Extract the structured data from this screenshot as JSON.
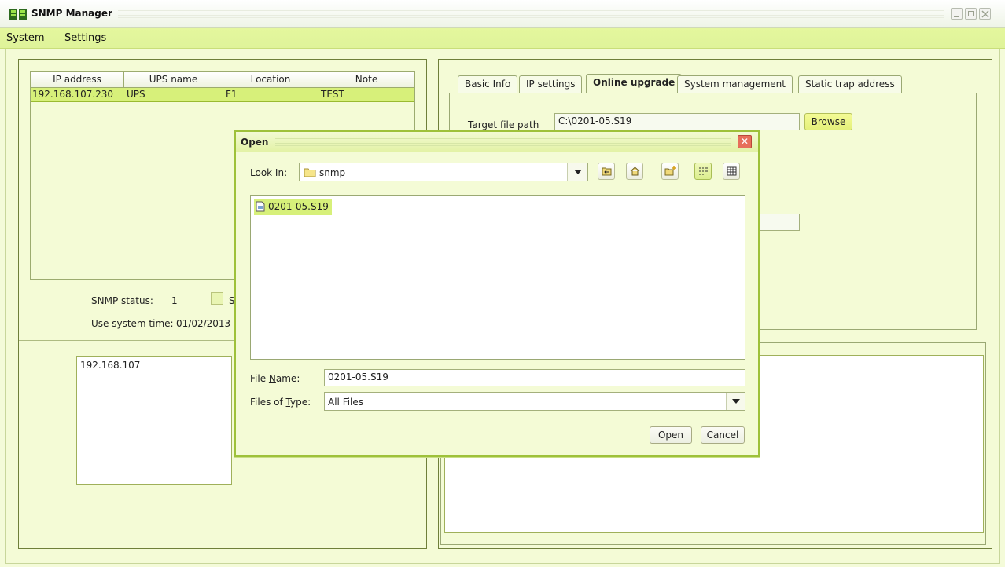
{
  "app": {
    "title": "SNMP Manager"
  },
  "menu": {
    "items": [
      "System",
      "Settings"
    ]
  },
  "device_table": {
    "columns": [
      "IP address",
      "UPS name",
      "Location",
      "Note"
    ],
    "rows": [
      {
        "ip": "192.168.107.230",
        "ups_name": "UPS",
        "location": "F1",
        "note": "TEST"
      }
    ]
  },
  "status": {
    "snmp_status_label": "SNMP status:",
    "snmp_status_value": "1",
    "checkbox_partial_label": "S",
    "use_system_time_label": "Use system time:",
    "use_system_time_value": "01/02/2013"
  },
  "ip_list": {
    "items": [
      "192.168.107"
    ]
  },
  "tabs": [
    {
      "label": "Basic Info",
      "active": false
    },
    {
      "label": "IP settings",
      "active": false
    },
    {
      "label": "Online upgrade",
      "active": true
    },
    {
      "label": "System management",
      "active": false
    },
    {
      "label": "Static trap address",
      "active": false
    }
  ],
  "online_upgrade": {
    "target_label": "Target file path",
    "target_value": "C:\\0201-05.S19",
    "browse_label": "Browse"
  },
  "open_dialog": {
    "title": "Open",
    "look_in_label": "Look In:",
    "look_in_value": "snmp",
    "files": [
      "0201-05.S19"
    ],
    "file_name_label": "File Name:",
    "file_name_value": "0201-05.S19",
    "files_of_type_label": "Files of Type:",
    "files_of_type_value": "All Files",
    "open_button": "Open",
    "cancel_button": "Cancel"
  },
  "colors": {
    "accent": "#d7f07a",
    "background": "#f4fbd6",
    "menubar": "#e2f59b"
  }
}
